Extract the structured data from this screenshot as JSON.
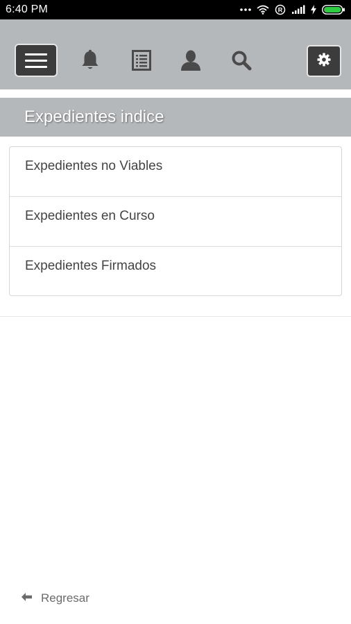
{
  "status_bar": {
    "time": "6:40 PM",
    "icons": [
      "more-dots-icon",
      "wifi-icon",
      "registered-icon",
      "signal-icon",
      "charging-icon",
      "battery-icon"
    ]
  },
  "toolbar": {
    "menu_icon": "hamburger-icon",
    "icons": [
      "bell-icon",
      "list-document-icon",
      "user-icon",
      "search-icon"
    ],
    "settings_icon": "gear-icon"
  },
  "section": {
    "title": "Expedientes indice"
  },
  "list": {
    "items": [
      {
        "label": "Expedientes no Viables"
      },
      {
        "label": "Expedientes en Curso"
      },
      {
        "label": "Expedientes Firmados"
      }
    ]
  },
  "footer": {
    "back_label": "Regresar",
    "back_icon": "arrow-left-icon"
  },
  "colors": {
    "toolbar_bg": "#b5b8bb",
    "button_dark": "#3c3c3c",
    "status_bar_bg": "#000000"
  }
}
